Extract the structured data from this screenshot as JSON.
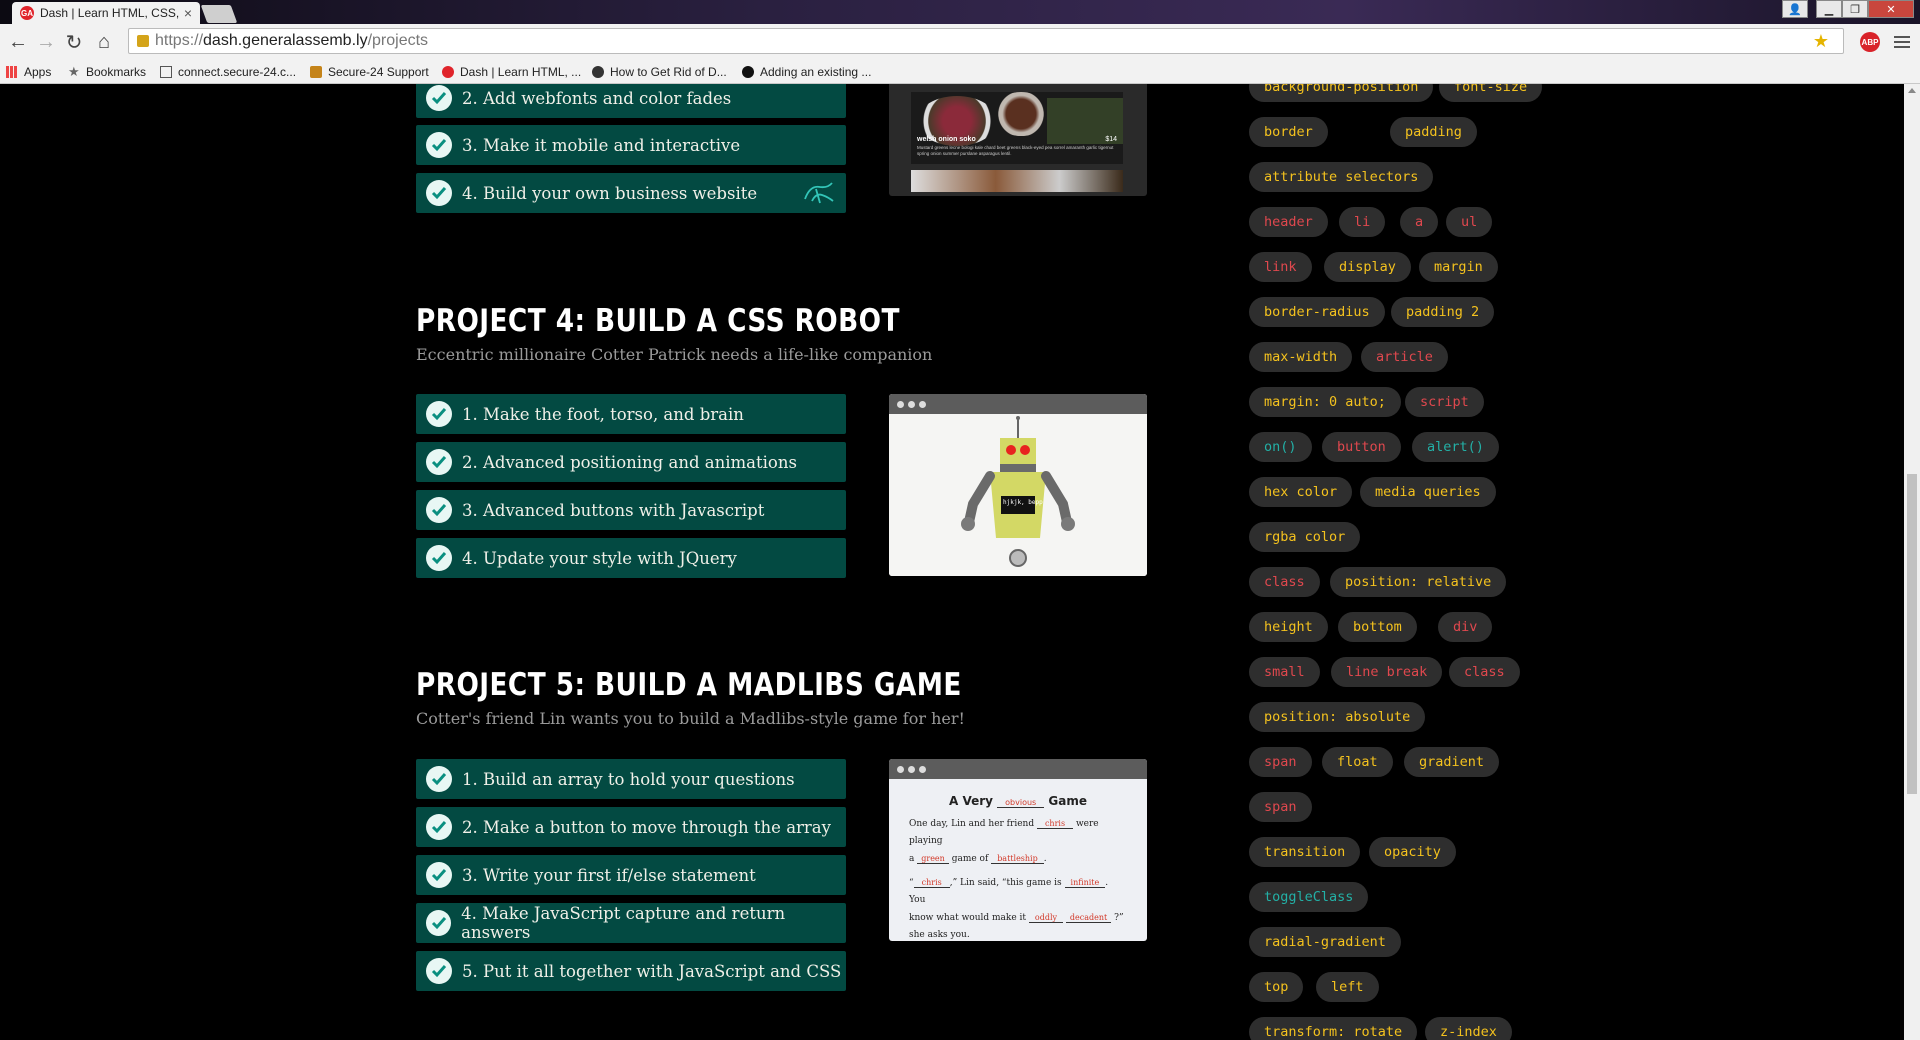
{
  "browser": {
    "tab_title": "Dash | Learn HTML, CSS, J",
    "tab_favicon": "GA",
    "url_scheme": "https://",
    "url_host": "dash.generalassemb.ly",
    "url_path": "/projects",
    "abp_label": "ABP",
    "bookmarks": [
      "Apps",
      "Bookmarks",
      "connect.secure-24.c...",
      "Secure-24 Support",
      "Dash | Learn HTML, ...",
      "How to Get Rid of D...",
      "Adding an existing ..."
    ]
  },
  "project3": {
    "steps": [
      "2. Add webfonts and color fades",
      "3. Make it mobile and interactive",
      "4. Build your own business website"
    ],
    "thumb": {
      "dish_name": "welsh onion soko",
      "price": "$14",
      "desc": "Mustard greens lecne bologi kale chard beet greens black-eyed pea sorrel amaranth garlic tigernut spring onion summer purslane asparagus lentil."
    }
  },
  "project4": {
    "title": "PROJECT 4: BUILD A CSS ROBOT",
    "subtitle": "Eccentric millionaire Cotter Patrick needs a life-like companion",
    "steps": [
      "1. Make the foot, torso, and brain",
      "2. Advanced positioning and animations",
      "3. Advanced buttons with Javascript",
      "4. Update your style with JQuery"
    ],
    "robot_screen": "hjkjk, bepp"
  },
  "project5": {
    "title": "PROJECT 5: BUILD A MADLIBS GAME",
    "subtitle": "Cotter's friend Lin wants you to build a Madlibs-style game for her!",
    "steps": [
      "1. Build an array to hold your questions",
      "2. Make a button to move through the array",
      "3. Write your first if/else statement",
      "4. Make JavaScript capture and return answers",
      "5. Put it all together with JavaScript and CSS"
    ],
    "madlib": {
      "h_pre": "A Very",
      "h_fill": "obvious",
      "h_post": "Game",
      "l1a": "One day, Lin and her friend",
      "l1_fill": "chris",
      "l1b": "were playing",
      "l2a": "a",
      "l2_fill1": "green",
      "l2b": "game of",
      "l2_fill2": "battleship",
      "l2c": ".",
      "l3a": "“",
      "l3_fill1": "chris",
      "l3b": ",” Lin said, “this game is",
      "l3_fill2": "infinite",
      "l3c": ". You",
      "l4a": "know what would make it",
      "l4_fill1": "oddly",
      "l4_fill2": "decadent",
      "l4b": "?”",
      "l5": "she asks you."
    }
  },
  "tags": [
    {
      "label": "background-position",
      "color": "yellow"
    },
    {
      "label": "font-size",
      "color": "yellow"
    },
    {
      "label": "border",
      "color": "yellow"
    },
    {
      "label": "padding",
      "color": "yellow"
    },
    {
      "label": "attribute selectors",
      "color": "yellow"
    },
    {
      "label": "header",
      "color": "red"
    },
    {
      "label": "li",
      "color": "red"
    },
    {
      "label": "a",
      "color": "red"
    },
    {
      "label": "ul",
      "color": "red"
    },
    {
      "label": "link",
      "color": "red"
    },
    {
      "label": "display",
      "color": "yellow"
    },
    {
      "label": "margin",
      "color": "yellow"
    },
    {
      "label": "border-radius",
      "color": "yellow"
    },
    {
      "label": "padding 2",
      "color": "yellow"
    },
    {
      "label": "max-width",
      "color": "yellow"
    },
    {
      "label": "article",
      "color": "red"
    },
    {
      "label": "margin: 0 auto;",
      "color": "yellow"
    },
    {
      "label": "script",
      "color": "red"
    },
    {
      "label": "on()",
      "color": "teal"
    },
    {
      "label": "button",
      "color": "red"
    },
    {
      "label": "alert()",
      "color": "teal"
    },
    {
      "label": "hex color",
      "color": "yellow"
    },
    {
      "label": "media queries",
      "color": "yellow"
    },
    {
      "label": "rgba color",
      "color": "yellow"
    },
    {
      "label": "class",
      "color": "red"
    },
    {
      "label": "position: relative",
      "color": "yellow"
    },
    {
      "label": "height",
      "color": "yellow"
    },
    {
      "label": "bottom",
      "color": "yellow"
    },
    {
      "label": "div",
      "color": "red"
    },
    {
      "label": "small",
      "color": "red"
    },
    {
      "label": "line break",
      "color": "red"
    },
    {
      "label": "class",
      "color": "red"
    },
    {
      "label": "position: absolute",
      "color": "yellow"
    },
    {
      "label": "span",
      "color": "red"
    },
    {
      "label": "float",
      "color": "yellow"
    },
    {
      "label": "gradient",
      "color": "yellow"
    },
    {
      "label": "span",
      "color": "red"
    },
    {
      "label": "transition",
      "color": "yellow"
    },
    {
      "label": "opacity",
      "color": "yellow"
    },
    {
      "label": "toggleClass",
      "color": "teal"
    },
    {
      "label": "radial-gradient",
      "color": "yellow"
    },
    {
      "label": "top",
      "color": "yellow"
    },
    {
      "label": "left",
      "color": "yellow"
    },
    {
      "label": "transform: rotate",
      "color": "yellow"
    },
    {
      "label": "z-index",
      "color": "yellow"
    }
  ],
  "colors": {
    "step_bg": "#034a42",
    "tag_bg": "#2e2e2e",
    "tag_yellow": "#f4c21e",
    "tag_red": "#e0484e",
    "tag_teal": "#23b0a6"
  }
}
